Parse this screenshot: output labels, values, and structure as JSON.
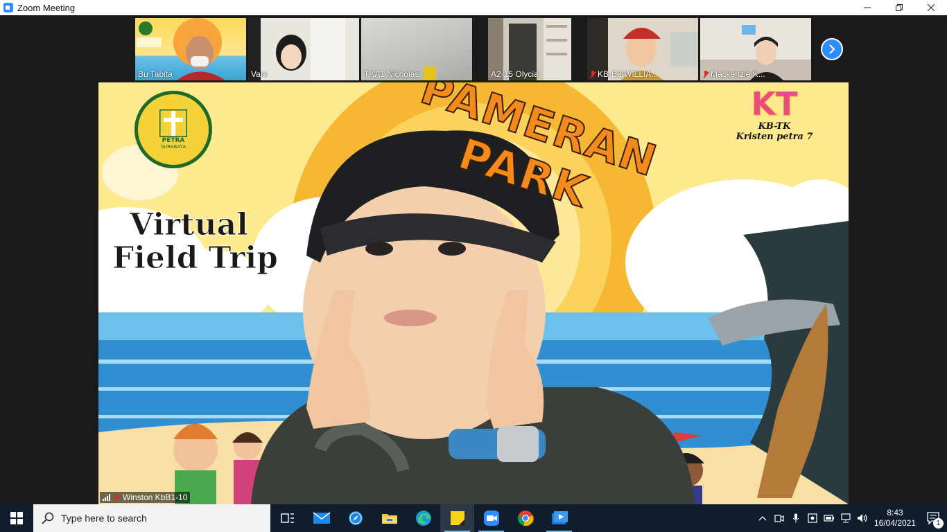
{
  "window": {
    "title": "Zoom Meeting"
  },
  "gallery": {
    "participants": [
      {
        "name": "Bu Tabita",
        "muted": false
      },
      {
        "name": "Vani",
        "muted": false
      },
      {
        "name": "TKA1 Nicholas",
        "muted": false
      },
      {
        "name": "A2-15 Olycia",
        "muted": false
      },
      {
        "name": "KB-B2/WILLIA...",
        "muted": true
      },
      {
        "name": "Mackenzie K...",
        "muted": true
      }
    ]
  },
  "main": {
    "speaker": "Winston KbB1-10",
    "muted": true,
    "banner_title": "PAMERAN PARK",
    "banner_subtitle_1": "Virtual",
    "banner_subtitle_2": "Field Trip",
    "logo_left_text": "PETRA",
    "logo_left_sub": "SURABAYA",
    "logo_right_text": "KT",
    "logo_right_sub1": "KB-TK",
    "logo_right_sub2": "Kristen petra 7"
  },
  "taskbar": {
    "search_placeholder": "Type here to search",
    "time": "8:43",
    "date": "16/04/2021",
    "notifications": "1"
  },
  "colors": {
    "zoom_blue": "#2d8cff",
    "taskbar_bg": "#101d2c",
    "muted_red": "#e02828"
  }
}
